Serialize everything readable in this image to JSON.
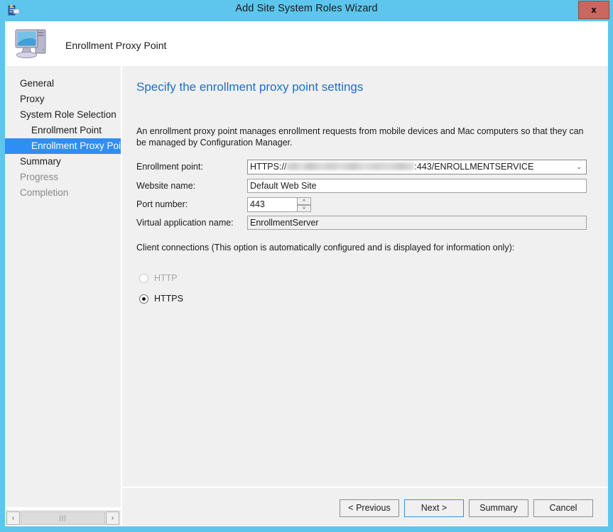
{
  "window": {
    "title": "Add Site System Roles Wizard",
    "icon": "wizard-icon",
    "close_label": "x",
    "accent_color": "#5ec5ec"
  },
  "header": {
    "icon": "computer-icon",
    "title": "Enrollment Proxy Point"
  },
  "sidebar": {
    "items": [
      {
        "label": "General",
        "state": "normal",
        "indent": false
      },
      {
        "label": "Proxy",
        "state": "normal",
        "indent": false
      },
      {
        "label": "System Role Selection",
        "state": "normal",
        "indent": false
      },
      {
        "label": "Enrollment Point",
        "state": "normal",
        "indent": true
      },
      {
        "label": "Enrollment Proxy Point",
        "state": "selected",
        "indent": true
      },
      {
        "label": "Summary",
        "state": "normal",
        "indent": false
      },
      {
        "label": "Progress",
        "state": "disabled",
        "indent": false
      },
      {
        "label": "Completion",
        "state": "disabled",
        "indent": false
      }
    ],
    "selected_color": "#2f8ef4",
    "scrollbar": {
      "left_arrow": "‹",
      "right_arrow": "›",
      "thumb_grip": "|||"
    }
  },
  "main": {
    "page_title": "Specify the enrollment proxy point settings",
    "page_title_color": "#1f6ec4",
    "description": "An enrollment proxy point manages enrollment requests from mobile devices and Mac computers so that they can be managed by Configuration Manager.",
    "fields": {
      "enrollment_point": {
        "label": "Enrollment point:",
        "value_prefix": "HTTPS://",
        "value_host_redacted": true,
        "value_suffix": ":443/ENROLLMENTSERVICE",
        "dropdown_arrow": "⌄"
      },
      "website_name": {
        "label": "Website name:",
        "value": "Default Web Site"
      },
      "port_number": {
        "label": "Port number:",
        "value": "443",
        "spin_up": "˄",
        "spin_down": "˅"
      },
      "virtual_application_name": {
        "label": "Virtual application name:",
        "value": "EnrollmentServer",
        "readonly": true
      }
    },
    "client_connections": {
      "label": "Client connections (This option is automatically configured and is displayed for information only):",
      "options": [
        {
          "label": "HTTP",
          "selected": false,
          "disabled": true
        },
        {
          "label": "HTTPS",
          "selected": true,
          "disabled": false
        }
      ]
    }
  },
  "footer": {
    "buttons": [
      {
        "label": "< Previous",
        "default": false
      },
      {
        "label": "Next >",
        "default": true
      },
      {
        "label": "Summary",
        "default": false
      },
      {
        "label": "Cancel",
        "default": false
      }
    ]
  }
}
